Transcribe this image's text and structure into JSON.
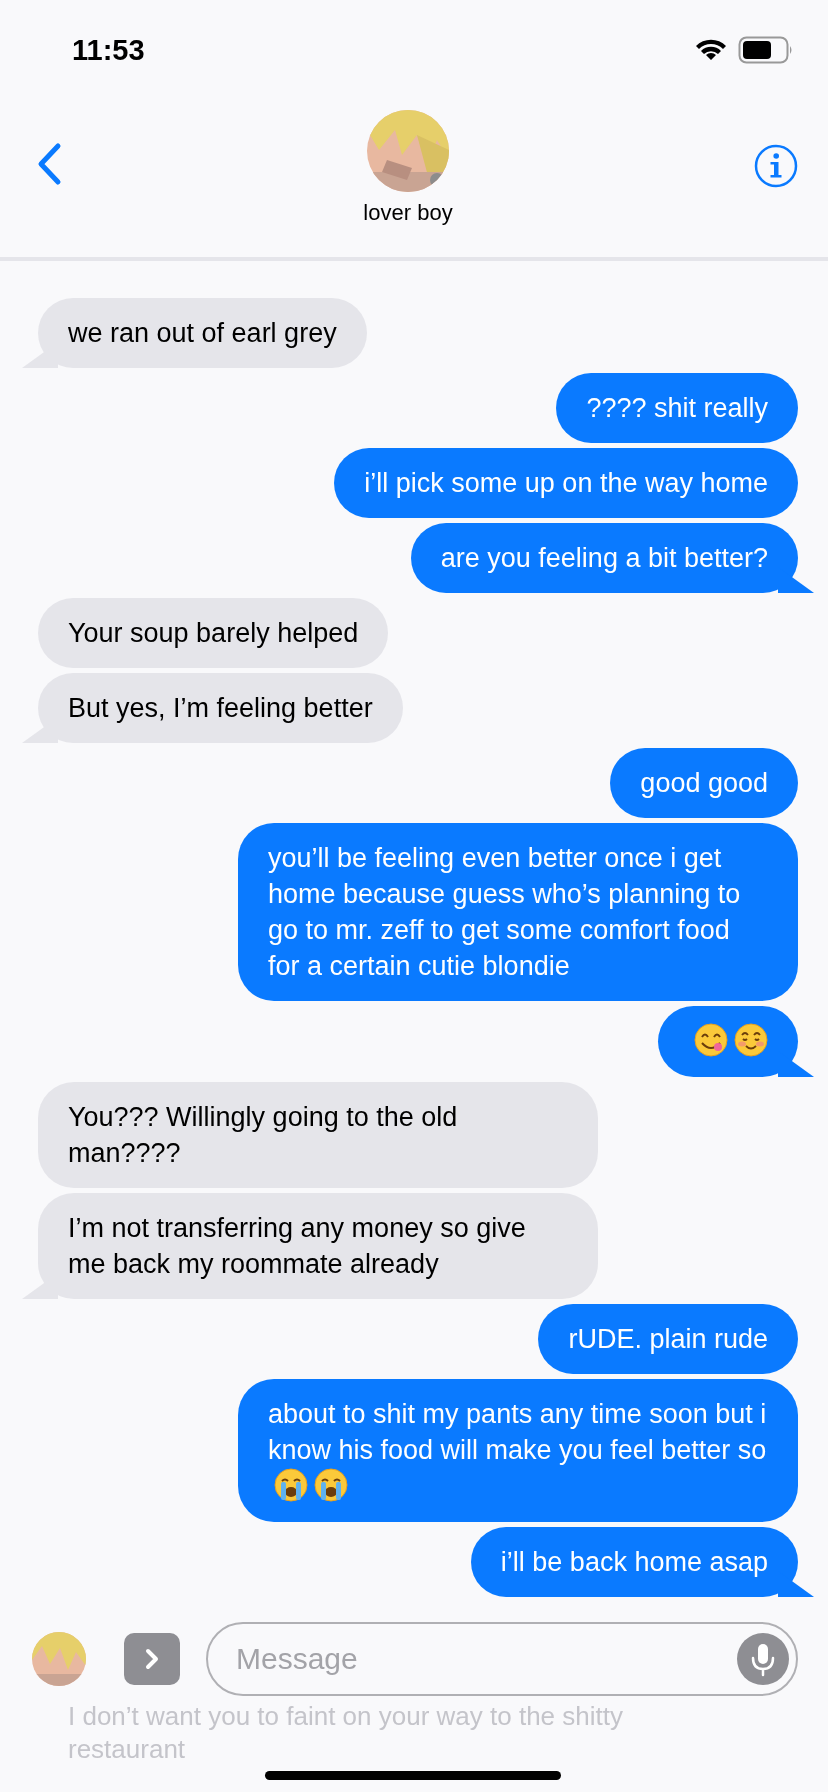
{
  "status_bar": {
    "time": "11:53"
  },
  "contact": {
    "name": "lover boy"
  },
  "messages": [
    {
      "kind": "received",
      "text": "we ran out of earl grey"
    },
    {
      "kind": "sent",
      "text": "???? shit really"
    },
    {
      "kind": "sent",
      "text": "i’ll pick some up on the way home"
    },
    {
      "kind": "sent",
      "text": "are you feeling a bit better?"
    },
    {
      "kind": "received",
      "text": "Your soup barely helped"
    },
    {
      "kind": "received",
      "text": "But yes, I’m feeling better"
    },
    {
      "kind": "sent",
      "text": "good good"
    },
    {
      "kind": "sent",
      "text": "you’ll be feeling even better once i get home because guess who’s planning to go to mr. zeff to get some comfort food for a certain cutie blondie"
    },
    {
      "kind": "sent",
      "emojis": [
        {
          "kind": "savoring"
        },
        {
          "kind": "blushing"
        }
      ]
    },
    {
      "kind": "received",
      "text": "You??? Willingly going to the old man????"
    },
    {
      "kind": "received",
      "text": "I’m not transferring any money so give me back my roommate already"
    },
    {
      "kind": "sent",
      "text": "rUDE. plain rude"
    },
    {
      "kind": "sent",
      "text": "about to shit my pants any time soon but i know his food will make you feel better so",
      "emojis": [
        {
          "kind": "crying"
        },
        {
          "kind": "crying"
        }
      ]
    },
    {
      "kind": "sent",
      "text": "i’ll be back home asap"
    }
  ],
  "compose": {
    "placeholder": "Message",
    "preview": "I don’t want you to faint on your way to the shitty restaurant"
  }
}
